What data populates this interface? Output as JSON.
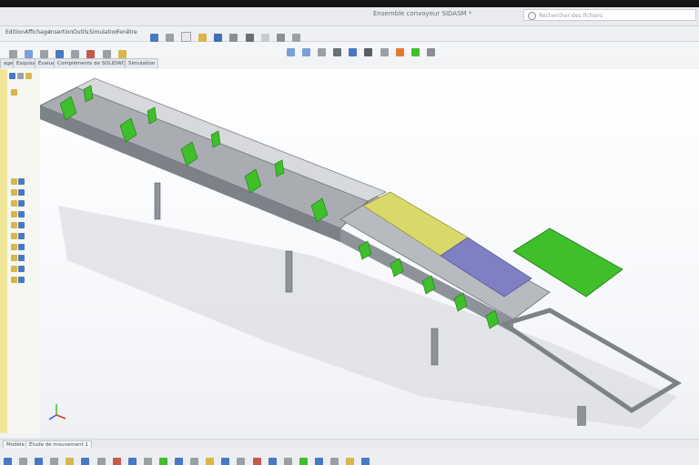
{
  "window": {
    "title": "Ensemble convoyeur SIDASM *",
    "search_placeholder": "Rechercher des fichiers"
  },
  "menu": {
    "items": [
      "Edition",
      "Affichage",
      "Insertion",
      "Outils",
      "Simulation",
      "Fenêtre"
    ]
  },
  "command_tabs": [
    "age",
    "Esquisse",
    "Évaluer",
    "Compléments de SOLIDWORKS",
    "Simulation"
  ],
  "bottom_tabs": [
    "Modèle",
    "Étude de mouvement 1"
  ],
  "colors": {
    "accent_green": "#3fbf2a",
    "frame_grey": "#8e9399",
    "panel_yellow": "#d9d86a",
    "panel_blue": "#7f7fc4",
    "shadow": "#c8cacd"
  }
}
